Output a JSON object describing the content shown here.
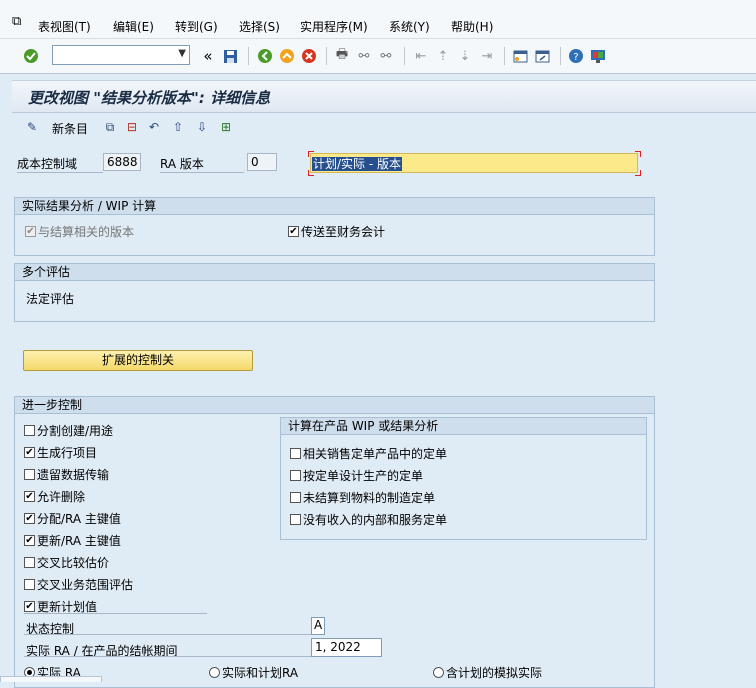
{
  "menu": [
    "表视图(T)",
    "编辑(E)",
    "转到(G)",
    "选择(S)",
    "实用程序(M)",
    "系统(Y)",
    "帮助(H)"
  ],
  "toolbar": {
    "command_value": "",
    "icons": [
      "enter-icon",
      "back-double-icon",
      "save-icon",
      "back-icon",
      "exit-icon",
      "cancel-icon",
      "print-icon",
      "find-icon",
      "find-next-icon",
      "first-page-icon",
      "prev-page-icon",
      "next-page-icon",
      "last-page-icon",
      "new-session-icon",
      "shortcut-icon",
      "help-icon",
      "customize-layout-icon"
    ]
  },
  "title": "更改视图 \"结果分析版本\": 详细信息",
  "app_toolbar": {
    "new_entries_label": "新条目"
  },
  "header": {
    "co_area_label": "成本控制域",
    "co_area_value": "6888",
    "ra_version_label": "RA 版本",
    "ra_version_value": "0",
    "version_text": "计划/实际 - 版本"
  },
  "actual_ra": {
    "title": "实际结果分析 / WIP 计算",
    "settlement_version_label": "与结算相关的版本",
    "settlement_version_checked": true,
    "transfer_fi_label": "传送至财务会计",
    "transfer_fi_checked": true
  },
  "multi_valuation": {
    "title": "多个评估",
    "legal_label": "法定评估"
  },
  "ext_button_label": "扩展的控制关",
  "further": {
    "title": "进一步控制",
    "items": [
      {
        "label": "分割创建/用途",
        "checked": false
      },
      {
        "label": "生成行项目",
        "checked": true
      },
      {
        "label": "遗留数据传输",
        "checked": false
      },
      {
        "label": "允许删除",
        "checked": true
      },
      {
        "label": "分配/RA 主键值",
        "checked": true
      },
      {
        "label": "更新/RA 主键值",
        "checked": true
      },
      {
        "label": "交叉比较估价",
        "checked": false
      },
      {
        "label": "交叉业务范围评估",
        "checked": false
      },
      {
        "label": "更新计划值",
        "checked": true
      }
    ],
    "status_control_label": "状态控制",
    "status_control_value": "A",
    "period_label": "实际 RA / 在产品的结帐期间",
    "period_value": "1, 2022",
    "radio": [
      {
        "label": "实际 RA",
        "selected": true
      },
      {
        "label": "实际和计划RA",
        "selected": false
      },
      {
        "label": "含计划的模拟实际",
        "selected": false
      }
    ]
  },
  "wip_calc": {
    "title": "计算在产品 WIP 或结果分析",
    "items": [
      {
        "label": "相关销售定单产品中的定单",
        "checked": false
      },
      {
        "label": "按定单设计生产的定单",
        "checked": false
      },
      {
        "label": "未结算到物料的制造定单",
        "checked": false
      },
      {
        "label": "没有收入的内部和服务定单",
        "checked": false
      }
    ]
  },
  "colors": {
    "background": "#dfebf5",
    "highlight_field": "#fbe98a",
    "selection": "#254f8f",
    "button_yellow": "#f4d96a"
  }
}
